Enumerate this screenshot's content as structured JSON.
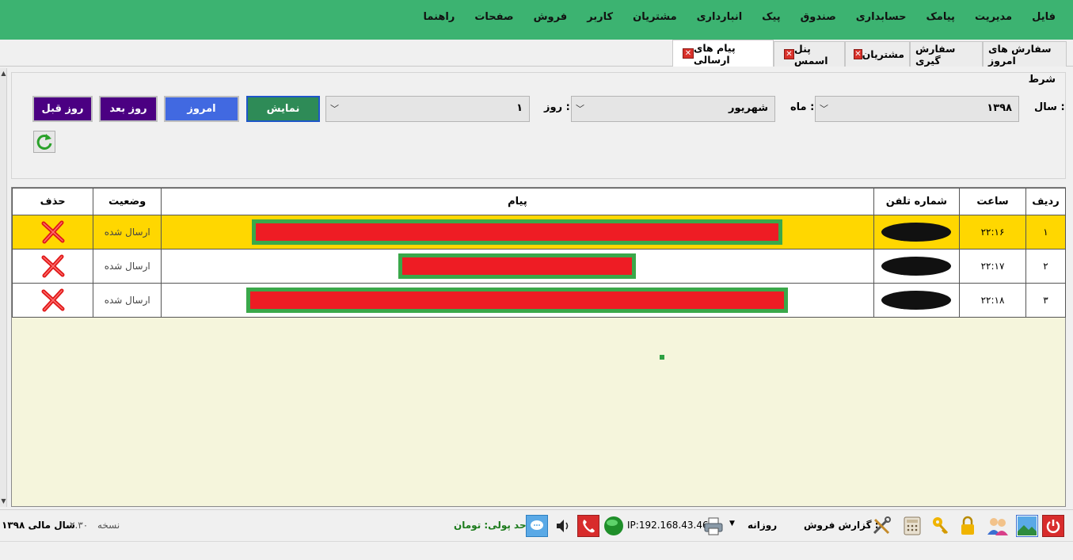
{
  "menu": [
    "فایل",
    "مدیریت",
    "پیامک",
    "حسابداری",
    "صندوق",
    "پیک",
    "انبارداری",
    "مشتریان",
    "کاربر",
    "فروش",
    "صفحات",
    "راهنما"
  ],
  "tabs": [
    {
      "label": "سفارش های امروز",
      "closable": false
    },
    {
      "label": "سفارش گیری",
      "closable": false
    },
    {
      "label": "مشتریان",
      "closable": true
    },
    {
      "label": "پنل اسمس",
      "closable": true
    },
    {
      "label": "پیام های ارسالی",
      "closable": true,
      "active": true
    }
  ],
  "filter": {
    "legend": "شرط",
    "year_label": "سال :",
    "year_value": "۱۳۹۸",
    "month_label": "ماه :",
    "month_value": "شهریور",
    "day_label": "روز :",
    "day_value": "۱",
    "show_button": "نمایش",
    "today_button": "امروز",
    "next_day_button": "روز بعد",
    "prev_day_button": "روز قبل"
  },
  "table": {
    "headers": {
      "row": "ردیف",
      "time": "ساعت",
      "phone": "شماره تلفن",
      "message": "پیام",
      "status": "وضعیت",
      "delete": "حذف"
    },
    "rows": [
      {
        "num": "۱",
        "time": "۲۲:۱۶",
        "status": "ارسال شده",
        "selected": true
      },
      {
        "num": "۲",
        "time": "۲۲:۱۷",
        "status": "ارسال شده",
        "selected": false
      },
      {
        "num": "۳",
        "time": "۲۲:۱۸",
        "status": "ارسال شده",
        "selected": false
      }
    ]
  },
  "statusbar": {
    "fiscal_year": "سال مالی ۱۳۹۸",
    "version_label": "نسخه",
    "version": "۲.۳۰",
    "currency": "واحد پولی: تومان",
    "ip": "IP:192.168.43.46",
    "report_label": "گزارش فروش :",
    "report_value": "روزانه"
  },
  "colors": {
    "menubar": "#3cb371",
    "selected_row": "#ffd700",
    "grid_background": "#f5f5dc",
    "show_button": "#2e8b57",
    "today_button": "#4169e1",
    "day_buttons": "#4b0082"
  }
}
